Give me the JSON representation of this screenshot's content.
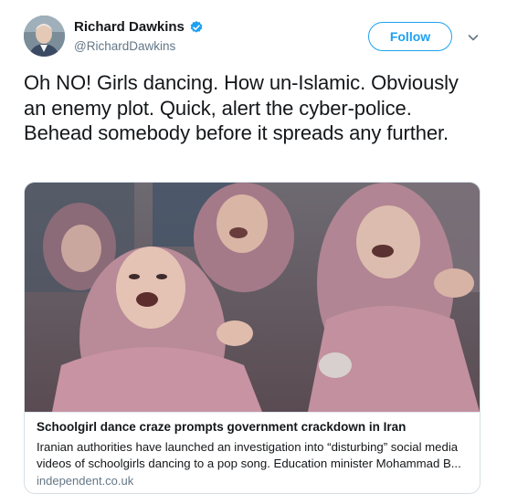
{
  "author": {
    "display_name": "Richard Dawkins",
    "handle": "@RichardDawkins",
    "verified": true
  },
  "actions": {
    "follow_label": "Follow"
  },
  "tweet": {
    "text": "Oh NO! Girls dancing. How un-Islamic. Obviously an enemy plot. Quick, alert the cyber-police. Behead somebody before it spreads any further."
  },
  "card": {
    "title": "Schoolgirl dance craze prompts government crackdown in Iran",
    "description": "Iranian authorities have launched an investigation into “disturbing” social media videos of schoolgirls dancing to a pop song. Education minister Mohammad B...",
    "domain": "independent.co.uk"
  },
  "colors": {
    "accent": "#1da1f2",
    "text_primary": "#14171a",
    "text_secondary": "#657786",
    "border": "#d8dfe4"
  },
  "icons": {
    "verified": "verified-badge-icon",
    "more": "chevron-down-icon"
  }
}
